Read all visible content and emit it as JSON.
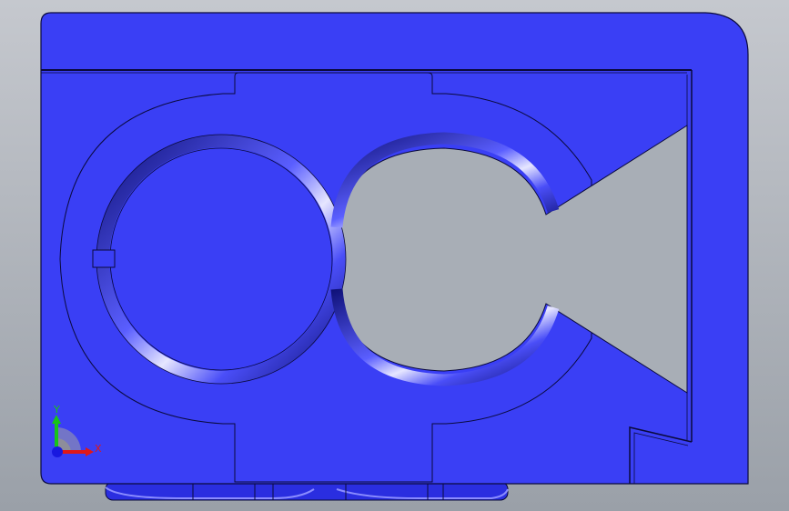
{
  "viewport": {
    "background_top": "#c5c8ce",
    "background_bottom": "#9aa0a8",
    "part_color": "#3a3ff5",
    "part_dark": "#1c1fa8",
    "edge_color": "#0a0a3c",
    "highlight": "#e8e8ff"
  },
  "triad": {
    "x_label": "X",
    "y_label": "Y",
    "x_color": "#e01818",
    "y_color": "#18c418",
    "z_color": "#1818e0"
  }
}
